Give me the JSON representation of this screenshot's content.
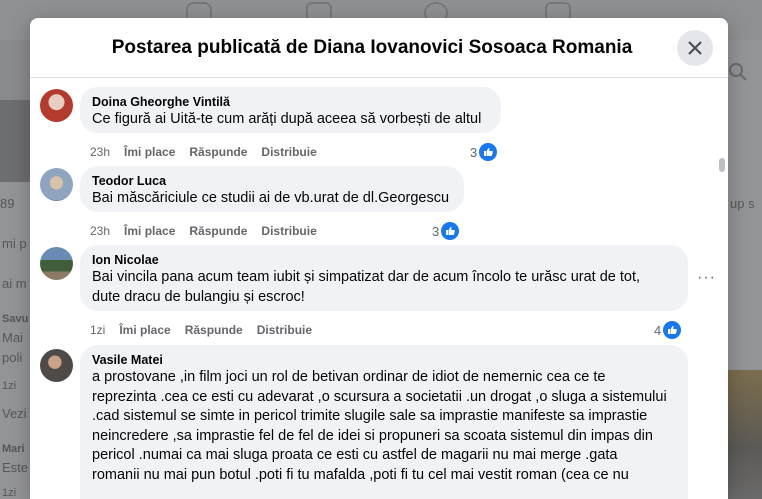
{
  "modal": {
    "title": "Postarea publicată de Diana Iovanovici Sosoaca Romania"
  },
  "background": {
    "left_texts": [
      "89",
      "mi p",
      "ai m",
      "Savu",
      "Mai",
      "poli",
      "1zi",
      "Vezi",
      "Mari",
      "Este",
      "1zi"
    ],
    "right_texts": [
      "up s"
    ]
  },
  "comments": [
    {
      "author": "Doina Gheorghe Vintilă",
      "text": "Ce figură ai Uită-te cum arăți după aceea să vorbești de altul",
      "time": "23h",
      "like": "Îmi place",
      "reply": "Răspunde",
      "share": "Distribuie",
      "reactions": "3"
    },
    {
      "author": "Teodor Luca",
      "text": "Bai măscăriciule ce studii ai de vb.urat de dl.Georgescu",
      "time": "23h",
      "like": "Îmi place",
      "reply": "Răspunde",
      "share": "Distribuie",
      "reactions": "3"
    },
    {
      "author": "Ion Nicolae",
      "text_lines": [
        "Bai vincila pana acum team iubit și simpatizat dar de acum încolo te urăsc urat de tot,",
        "dute dracu de bulangiu și escroc!"
      ],
      "time": "1zi",
      "like": "Îmi place",
      "reply": "Răspunde",
      "share": "Distribuie",
      "reactions": "4"
    },
    {
      "author": "Vasile Matei",
      "text_lines": [
        "a prostovane ,in film joci un rol de betivan ordinar de idiot de nemernic cea ce te",
        "reprezinta .cea ce esti cu adevarat ,o scursura a societatii .un drogat ,o sluga a sistemului",
        ".cad sistemul se simte in pericol trimite slugile sale sa imprastie manifeste sa imprastie",
        "neincredere ,sa imprastie fel de fel de idei si propuneri sa scoata sistemul din impas din",
        "pericol .numai ca mai sluga proata ce esti cu astfel de magarii nu mai merge .gata",
        "romanii nu mai pun botul .poti fi tu mafalda ,poti fi tu cel mai vestit roman (cea ce nu"
      ]
    }
  ]
}
